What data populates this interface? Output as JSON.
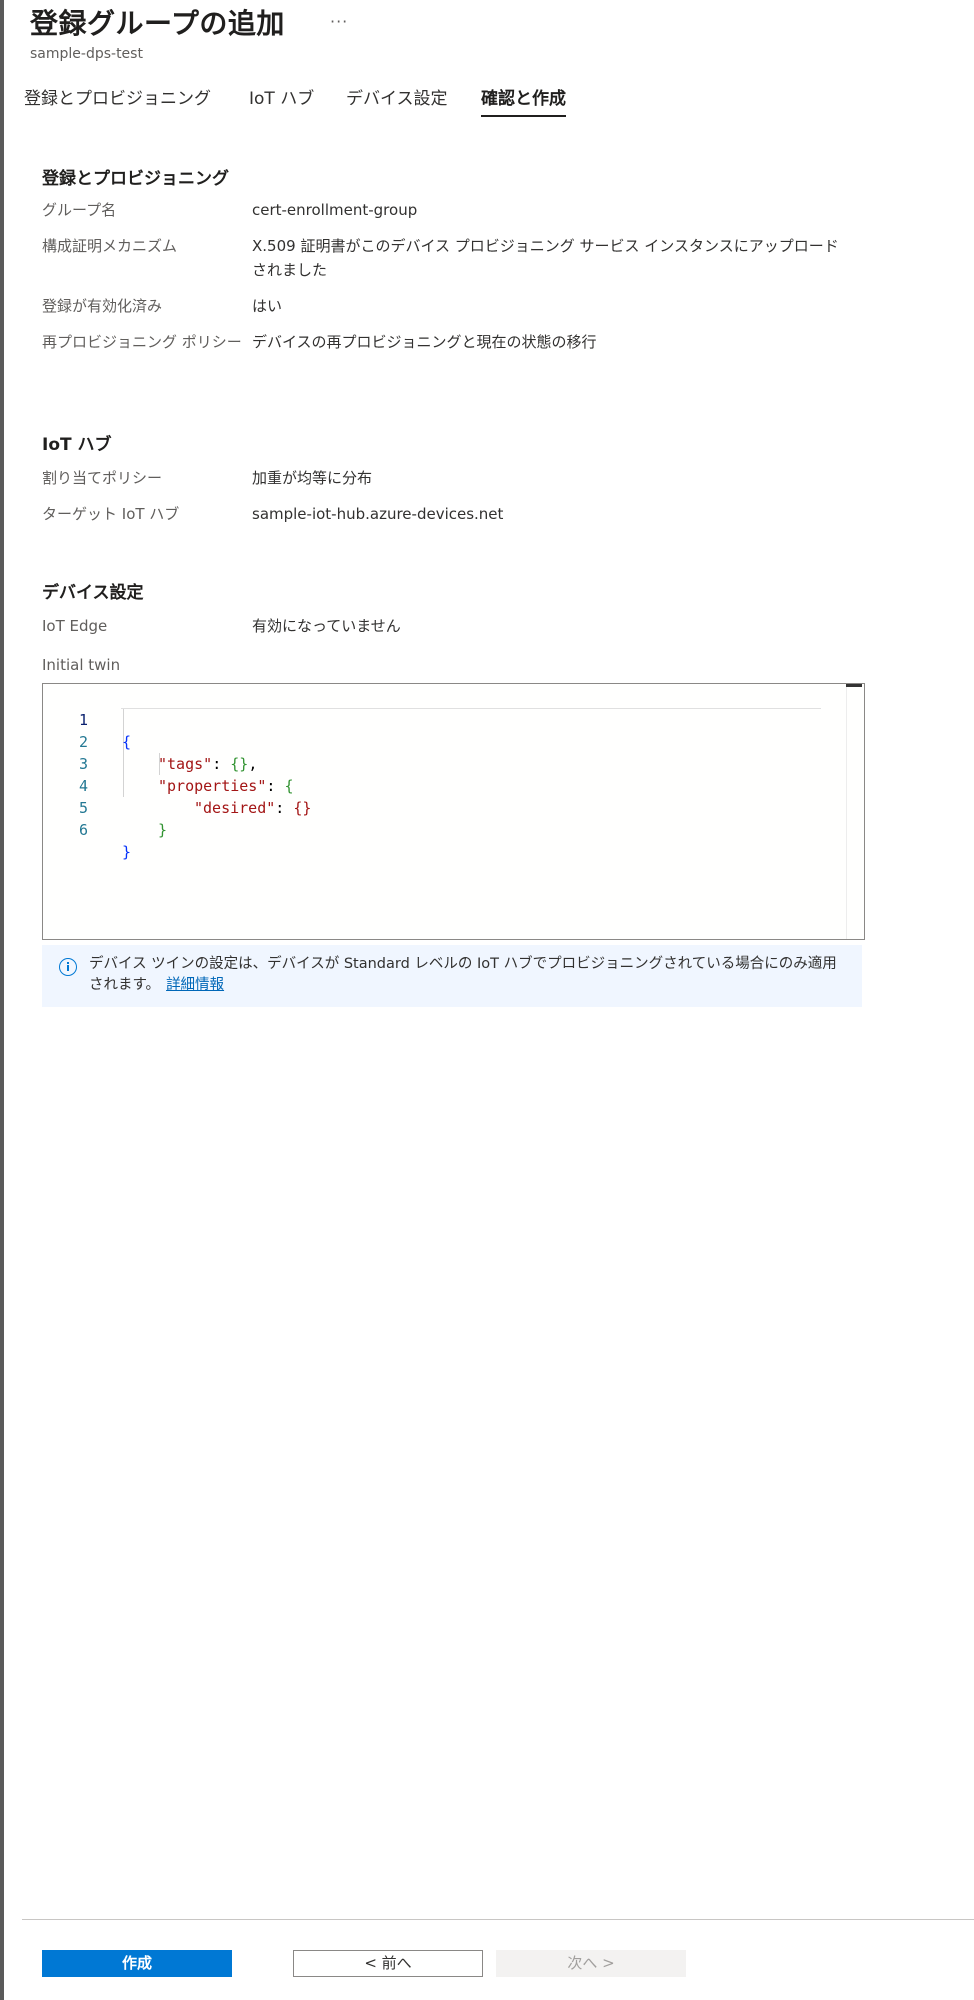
{
  "header": {
    "title": "登録グループの追加",
    "more_label": "···",
    "subtitle": "sample-dps-test"
  },
  "tabs": [
    {
      "label": "登録とプロビジョニング",
      "active": false
    },
    {
      "label": "IoT ハブ",
      "active": false
    },
    {
      "label": "デバイス設定",
      "active": false
    },
    {
      "label": "確認と作成",
      "active": true
    }
  ],
  "review": {
    "provisioning": {
      "heading": "登録とプロビジョニング",
      "rows": [
        {
          "label": "グループ名",
          "value": "cert-enrollment-group"
        },
        {
          "label": "構成証明メカニズム",
          "value": "X.509 証明書がこのデバイス プロビジョニング サービス インスタンスにアップロードされました"
        },
        {
          "label": "登録が有効化済み",
          "value": "はい"
        },
        {
          "label": "再プロビジョニング ポリシー",
          "value": "デバイスの再プロビジョニングと現在の状態の移行"
        }
      ]
    },
    "iot_hub": {
      "heading": "IoT ハブ",
      "rows": [
        {
          "label": "割り当てポリシー",
          "value": "加重が均等に分布"
        },
        {
          "label": "ターゲット IoT ハブ",
          "value": "sample-iot-hub.azure-devices.net"
        }
      ]
    },
    "device_settings": {
      "heading": "デバイス設定",
      "rows": [
        {
          "label": "IoT Edge",
          "value": "有効になっていません"
        }
      ]
    }
  },
  "initial_twin": {
    "label": "Initial twin",
    "line_numbers": [
      "1",
      "2",
      "3",
      "4",
      "5",
      "6"
    ],
    "lines": [
      {
        "open_brace": "{"
      },
      {
        "key": "\"tags\"",
        "colon": ": ",
        "braces": "{}",
        "trail": ","
      },
      {
        "key": "\"properties\"",
        "colon": ": ",
        "open_brace": "{"
      },
      {
        "key": "\"desired\"",
        "colon": ": ",
        "braces": "{}"
      },
      {
        "close_brace": "}"
      },
      {
        "close_brace": "}"
      }
    ]
  },
  "info": {
    "text": "デバイス ツインの設定は、デバイスが Standard レベルの IoT ハブでプロビジョニングされている場合にのみ適用されます。",
    "link": "詳細情報"
  },
  "footer": {
    "create_label": "作成",
    "prev_label": "< 前へ",
    "next_label": "次へ >"
  }
}
